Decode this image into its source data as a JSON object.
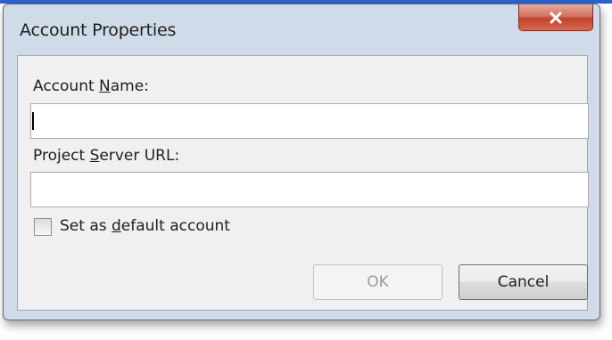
{
  "dialog": {
    "title": "Account Properties",
    "close_icon": "close-x-icon"
  },
  "fields": {
    "account_name": {
      "label_pre": "Account ",
      "label_key": "N",
      "label_post": "ame:",
      "value": ""
    },
    "server_url": {
      "label_pre": "Project ",
      "label_key": "S",
      "label_post": "erver URL:",
      "value": ""
    }
  },
  "default_account": {
    "label_pre": "Set as ",
    "label_key": "d",
    "label_post": "efault account",
    "checked": false
  },
  "buttons": {
    "ok_label": "OK",
    "cancel_label": "Cancel"
  },
  "colors": {
    "close_button": "#c1432b",
    "dialog_frame": "#cfdbe9",
    "client_area": "#f0f0f0"
  }
}
